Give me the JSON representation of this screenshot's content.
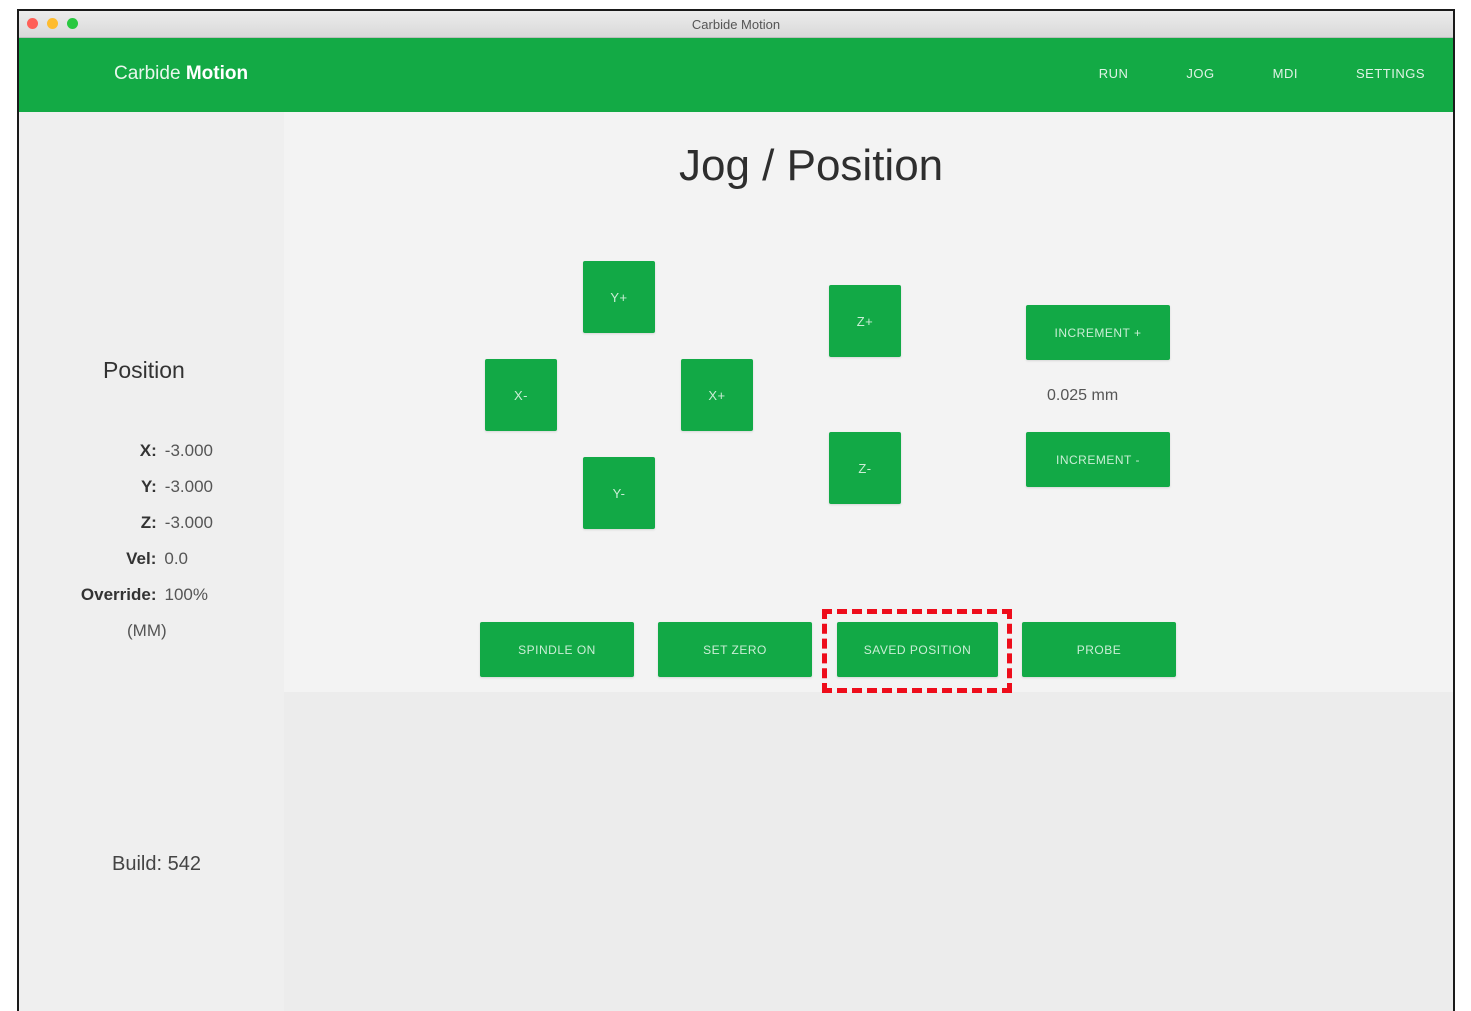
{
  "window": {
    "title": "Carbide Motion"
  },
  "navbar": {
    "brand_light": "Carbide ",
    "brand_bold": "Motion",
    "links": [
      "RUN",
      "JOG",
      "MDI",
      "SETTINGS"
    ]
  },
  "page": {
    "title": "Jog / Position"
  },
  "sidebar": {
    "heading": "Position",
    "readouts": [
      {
        "label": "X:",
        "value": "-3.000"
      },
      {
        "label": "Y:",
        "value": "-3.000"
      },
      {
        "label": "Z:",
        "value": "-3.000"
      },
      {
        "label": "Vel:",
        "value": "0.0"
      },
      {
        "label": "Override:",
        "value": "100%"
      }
    ],
    "units": "(MM)",
    "build": "Build: 542"
  },
  "jog": {
    "y_plus": "Y+",
    "x_minus": "X-",
    "x_plus": "X+",
    "y_minus": "Y-",
    "z_plus": "Z+",
    "z_minus": "Z-"
  },
  "increment": {
    "up_label": "INCREMENT +",
    "value": "0.025 mm",
    "down_label": "INCREMENT -"
  },
  "actions": {
    "spindle": "SPINDLE ON",
    "set_zero": "SET ZERO",
    "saved_position": "SAVED POSITION",
    "probe": "PROBE"
  },
  "colors": {
    "accent": "#13aa45",
    "highlight": "#ee0d1b"
  }
}
